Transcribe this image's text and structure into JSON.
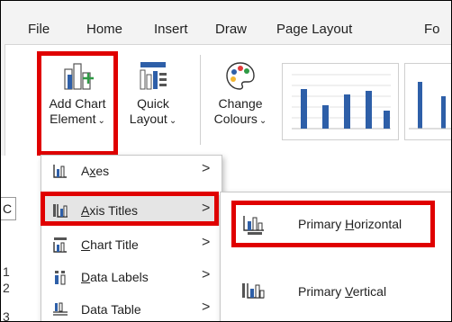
{
  "tabs": [
    "File",
    "Home",
    "Insert",
    "Draw",
    "Page Layout",
    "Fo"
  ],
  "ribbon": {
    "add_chart_element": {
      "line1": "Add Chart",
      "line2": "Element",
      "caret": "⌄"
    },
    "quick_layout": {
      "line1": "Quick",
      "line2": "Layout",
      "caret": "⌄"
    },
    "change_colours": {
      "line1": "Change",
      "line2": "Colours",
      "caret": "⌄"
    }
  },
  "sheet": {
    "name_box_text": "C",
    "row_numbers": [
      "1",
      "2",
      "3"
    ]
  },
  "menu": {
    "items": [
      {
        "pre": "A",
        "ul": "x",
        "post": "es",
        "icon": "axes-icon",
        "arrow": ">"
      },
      {
        "pre": "",
        "ul": "A",
        "post": "xis Titles",
        "icon": "axis-titles-icon",
        "arrow": ">"
      },
      {
        "pre": "",
        "ul": "C",
        "post": "hart Title",
        "icon": "chart-title-icon",
        "arrow": ">"
      },
      {
        "pre": "",
        "ul": "D",
        "post": "ata Labels",
        "icon": "data-labels-icon",
        "arrow": ">"
      },
      {
        "pre": "Data Ta",
        "ul": "",
        "post": "ble",
        "icon": "data-table-icon",
        "arrow": ">"
      }
    ]
  },
  "submenu": {
    "items": [
      {
        "pre": "Primary ",
        "ul": "H",
        "post": "orizontal",
        "icon": "primary-horizontal-axis-title-icon"
      },
      {
        "pre": "Primary ",
        "ul": "V",
        "post": "ertical",
        "icon": "primary-vertical-axis-title-icon"
      }
    ]
  },
  "colors": {
    "highlight": "#e00000",
    "chart_bar": "#2e5fa8",
    "icon_green": "#2f9a45"
  }
}
